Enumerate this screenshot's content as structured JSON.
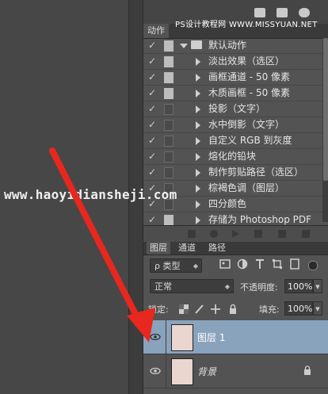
{
  "watermark_top": "PS设计教程网 WWW.MISSYUAN.NET",
  "watermark_main": "www.haoyidiansheji.com",
  "actions_panel": {
    "tab_label": "动作",
    "set_name": "默认动作",
    "items": [
      {
        "label": "淡出效果（选区）",
        "checked": true,
        "dialog": true
      },
      {
        "label": "画框通道 - 50 像素",
        "checked": true,
        "dialog": true
      },
      {
        "label": "木质画框 - 50 像素",
        "checked": true,
        "dialog": true
      },
      {
        "label": "投影（文字）",
        "checked": true,
        "dialog": false
      },
      {
        "label": "水中倒影（文字）",
        "checked": true,
        "dialog": false
      },
      {
        "label": "自定义 RGB 到灰度",
        "checked": true,
        "dialog": false
      },
      {
        "label": "熔化的铅块",
        "checked": true,
        "dialog": false
      },
      {
        "label": "制作剪贴路径（选区）",
        "checked": true,
        "dialog": false
      },
      {
        "label": "棕褐色调（图层）",
        "checked": true,
        "dialog": false
      },
      {
        "label": "四分颜色",
        "checked": true,
        "dialog": false
      },
      {
        "label": "存储为 Photoshop PDF",
        "checked": true,
        "dialog": true
      }
    ]
  },
  "layers_panel": {
    "tabs": [
      "图层",
      "通道",
      "路径"
    ],
    "filter_kind": "ρ 类型",
    "blend_mode": "正常",
    "opacity_label": "不透明度:",
    "opacity_value": "100%",
    "lock_label": "锁定:",
    "fill_label": "填充:",
    "fill_value": "100%",
    "layers": [
      {
        "name": "图层 1",
        "selected": true,
        "locked": false
      },
      {
        "name": "背景",
        "selected": false,
        "locked": true
      }
    ]
  },
  "colors": {
    "arrow": "#e8271e",
    "selected_layer": "#8aa3bd"
  }
}
